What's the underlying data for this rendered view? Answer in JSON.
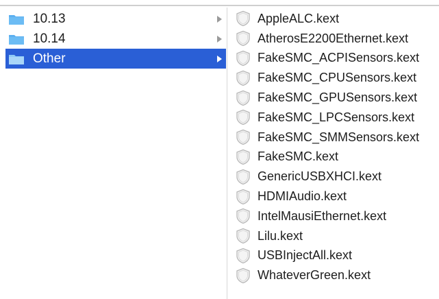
{
  "colors": {
    "selection": "#2a5fd6",
    "folder": "#5cb0f0",
    "text": "#1d1d1d"
  },
  "left_column": {
    "folders": [
      {
        "label": "10.13",
        "icon": "folder-icon",
        "selected": false
      },
      {
        "label": "10.14",
        "icon": "folder-icon",
        "selected": false
      },
      {
        "label": "Other",
        "icon": "folder-icon",
        "selected": true
      }
    ]
  },
  "right_column": {
    "files": [
      {
        "label": "AppleALC.kext",
        "icon": "kext-icon"
      },
      {
        "label": "AtherosE2200Ethernet.kext",
        "icon": "kext-icon"
      },
      {
        "label": "FakeSMC_ACPISensors.kext",
        "icon": "kext-icon"
      },
      {
        "label": "FakeSMC_CPUSensors.kext",
        "icon": "kext-icon"
      },
      {
        "label": "FakeSMC_GPUSensors.kext",
        "icon": "kext-icon"
      },
      {
        "label": "FakeSMC_LPCSensors.kext",
        "icon": "kext-icon"
      },
      {
        "label": "FakeSMC_SMMSensors.kext",
        "icon": "kext-icon"
      },
      {
        "label": "FakeSMC.kext",
        "icon": "kext-icon"
      },
      {
        "label": "GenericUSBXHCI.kext",
        "icon": "kext-icon"
      },
      {
        "label": "HDMIAudio.kext",
        "icon": "kext-icon"
      },
      {
        "label": "IntelMausiEthernet.kext",
        "icon": "kext-icon"
      },
      {
        "label": "Lilu.kext",
        "icon": "kext-icon"
      },
      {
        "label": "USBInjectAll.kext",
        "icon": "kext-icon"
      },
      {
        "label": "WhateverGreen.kext",
        "icon": "kext-icon"
      }
    ]
  }
}
